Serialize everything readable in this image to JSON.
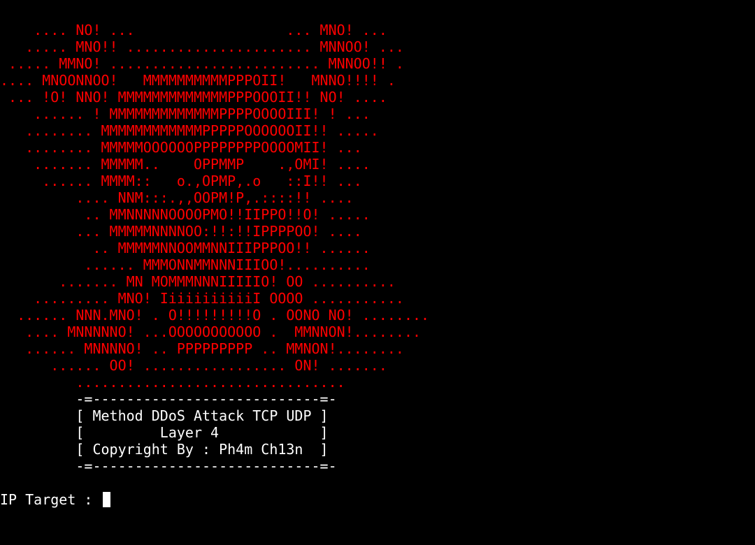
{
  "terminal": {
    "colors": {
      "background": "#000000",
      "art": "#ff0000",
      "text": "#ffffff"
    },
    "art_lines": [
      "    .... NO! ...                  ... MNO! ...",
      "   ..... MNO!! ...................... MNNOO! ...",
      " ..... MMNO! ......................... MNNOO!! .",
      ".... MNOONNOO!   MMMMMMMMMMPPPOII!   MNNO!!!! .",
      " ... !O! NNO! MMMMMMMMMMMMMPPPOOOII!! NO! ....",
      "    ...... ! MMMMMMMMMMMMMPPPPOOOOIII! ! ...",
      "   ........ MMMMMMMMMMMMPPPPPOOOOOOII!! .....",
      "   ........ MMMMMOOOOOOPPPPPPPPOOOOMII! ...",
      "    ....... MMMMM..    OPPMMP    .,OMI! ....",
      "     ...... MMMM::   o.,OPMP,.o   ::I!! ...",
      "         .... NNM:::.,,OOPM!P,.::::!! ....",
      "          .. MMNNNNNOOOOPMO!!IIPPO!!O! .....",
      "         ... MMMMMNNNNOO:!!:!!IPPPPOO! ....",
      "           .. MMMMMNNOOMMNNIIIPPPOO!! ......",
      "          ...... MMMONNMMNNNIIIOO!..........",
      "       ....... MN MOMMMNNNIIIIIO! OO ..........",
      "    ......... MNO! IiiiiiiiiiiI OOOO ...........",
      "  ...... NNN.MNO! . O!!!!!!!!!O . OONO NO! ........",
      "   .... MNNNNNO! ...OOOOOOOOOOO .  MMNNON!........",
      "   ...... MNNNNO! .. PPPPPPPPP .. MMNON!........",
      "      ...... OO! ................. ON! .......",
      "         ................................"
    ],
    "banner_lines": [
      "         -=---------------------------=-",
      "         [ Method DDoS Attack TCP UDP ]",
      "         [         Layer 4            ]",
      "         [ Copyright By : Ph4m Ch13n  ]",
      "         -=---------------------------=-"
    ],
    "prompt_label": "IP Target : "
  }
}
